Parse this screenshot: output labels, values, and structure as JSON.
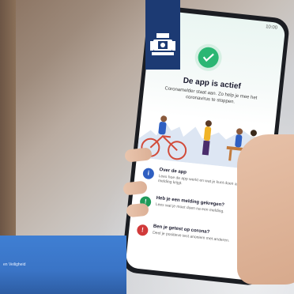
{
  "app": {
    "title": "De app is actief",
    "subtitle": "Coronamelder staat aan. Zo help je mee het coronavirus te stoppen.",
    "status_bar": "10:00"
  },
  "info_items": [
    {
      "icon": "info-icon",
      "title": "Over de app",
      "desc": "Lees hoe de app werkt en wat je kunt doen als je een melding krijgt."
    },
    {
      "icon": "notification-icon",
      "title": "Heb je een melding gekregen?",
      "desc": "Lees wat je moet doen na een melding."
    },
    {
      "icon": "alert-icon",
      "title": "Ben je getest op corona?",
      "desc": "Deel je positieve test anoniem met anderen."
    }
  ],
  "laptop": {
    "text": "en Veiligheid"
  },
  "colors": {
    "logo_bg": "#1c3a73",
    "check_green": "#2bb673",
    "laptop_blue": "#3f7fd3"
  }
}
